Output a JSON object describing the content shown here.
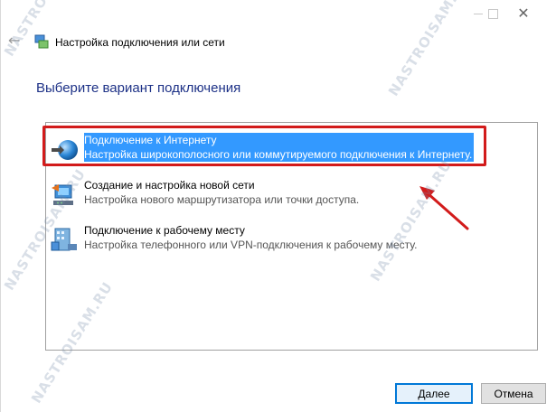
{
  "window": {
    "header_title": "Настройка подключения или сети",
    "page_title": "Выберите вариант подключения"
  },
  "options": [
    {
      "title": "Подключение к Интернету",
      "description": "Настройка широкополосного или коммутируемого подключения к Интернету.",
      "icon": "globe-network-icon",
      "selected": true
    },
    {
      "title": "Создание и настройка новой сети",
      "description": "Настройка нового маршрутизатора или точки доступа.",
      "icon": "router-setup-icon",
      "selected": false
    },
    {
      "title": "Подключение к рабочему месту",
      "description": "Настройка телефонного или VPN-подключения к рабочему месту.",
      "icon": "workplace-connection-icon",
      "selected": false
    }
  ],
  "buttons": {
    "next": "Далее",
    "cancel": "Отмена"
  },
  "watermark": "NASTROISAM.RU",
  "colors": {
    "selection": "#3399ff",
    "highlight_frame": "#d21b1b",
    "title_blue": "#1e3287"
  }
}
